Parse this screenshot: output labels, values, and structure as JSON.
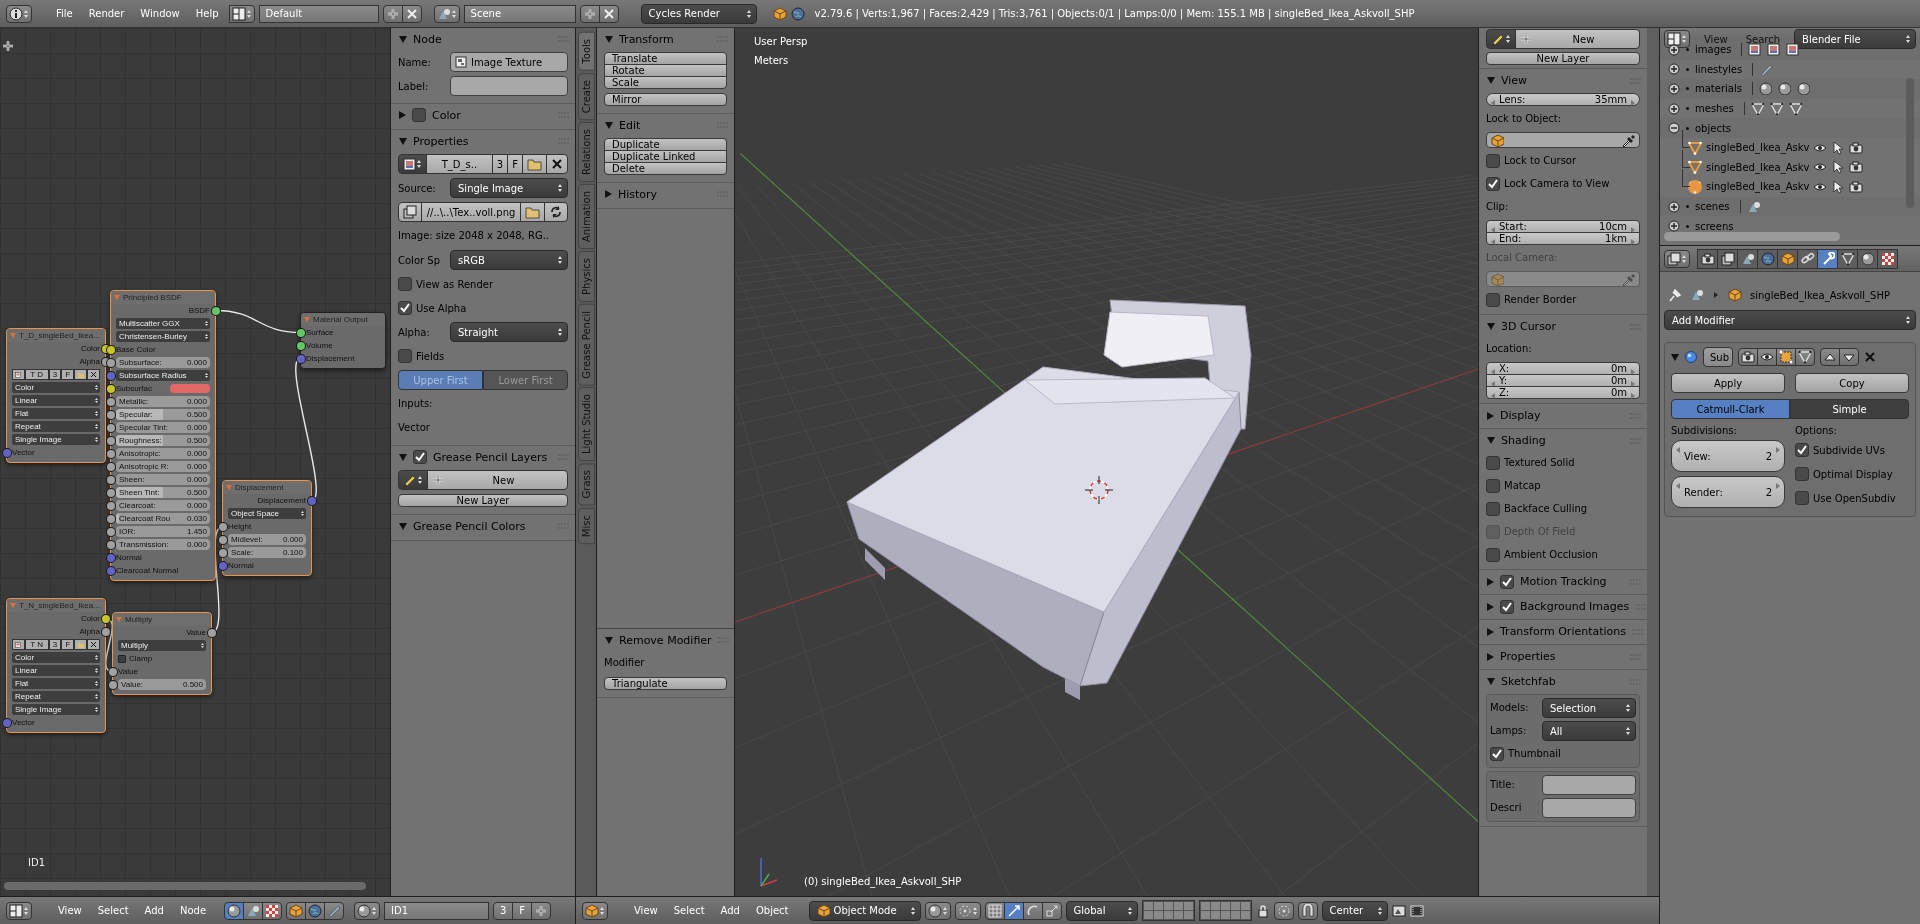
{
  "top_bar": {
    "menus": [
      "File",
      "Render",
      "Window",
      "Help"
    ],
    "layout": "Default",
    "scene": "Scene",
    "engine": "Cycles Render",
    "stats": "v2.79.6 | Verts:1,967 | Faces:2,429 | Tris:3,761 | Objects:0/1 | Lamps:0/0 | Mem: 155.1 MB | singleBed_Ikea_Askvoll_SHP"
  },
  "node_editor": {
    "tree_label": "ID1",
    "nodes": [
      {
        "title": "T_D_singleBed_Ikea...",
        "selected": true,
        "rows": [
          {
            "kind": "output",
            "text": "Color",
            "color": "#c7c729"
          },
          {
            "kind": "output",
            "text": "Alpha",
            "color": "#a1a1a1"
          },
          {
            "kind": "image_bar",
            "name": "T D",
            "users": "3",
            "fake": "F"
          },
          {
            "kind": "dropdown",
            "value": "Color"
          },
          {
            "kind": "dropdown",
            "value": "Linear"
          },
          {
            "kind": "dropdown",
            "value": "Flat"
          },
          {
            "kind": "dropdown",
            "value": "Repeat"
          },
          {
            "kind": "dropdown",
            "value": "Single Image"
          },
          {
            "kind": "input",
            "text": "Vector",
            "color": "#6363c7"
          }
        ]
      },
      {
        "title": "Principled BSDF",
        "selected": true,
        "rows": [
          {
            "kind": "output",
            "text": "BSDF",
            "color": "#63c763"
          },
          {
            "kind": "dropdown",
            "value": "Multiscatter GGX"
          },
          {
            "kind": "dropdown",
            "value": "Christensen-Burley"
          },
          {
            "kind": "input",
            "text": "Base Color",
            "color": "#c7c729"
          },
          {
            "kind": "value",
            "label": "Subsurface:",
            "value": "0.000",
            "color": "#a1a1a1",
            "level": 0
          },
          {
            "kind": "vector",
            "label": "Subsurface Radius",
            "color": "#6363c7"
          },
          {
            "kind": "swatch",
            "label": "Subsurfac",
            "socket": {
              "color": "#c7c729"
            },
            "color": "#e36868"
          },
          {
            "kind": "value",
            "label": "Metallic:",
            "value": "0.000",
            "color": "#a1a1a1",
            "level": 0
          },
          {
            "kind": "value",
            "label": "Specular:",
            "value": "0.500",
            "color": "#a1a1a1",
            "level": 0.5
          },
          {
            "kind": "value",
            "label": "Specular Tint:",
            "value": "0.000",
            "color": "#a1a1a1",
            "level": 0
          },
          {
            "kind": "value",
            "label": "Roughness:",
            "value": "0.500",
            "color": "#a1a1a1",
            "level": 0.5
          },
          {
            "kind": "value",
            "label": "Anisotropic:",
            "value": "0.000",
            "color": "#a1a1a1",
            "level": 0
          },
          {
            "kind": "value",
            "label": "Anisotropic R:",
            "value": "0.000",
            "color": "#a1a1a1",
            "level": 0
          },
          {
            "kind": "value",
            "label": "Sheen:",
            "value": "0.000",
            "color": "#a1a1a1",
            "level": 0
          },
          {
            "kind": "value",
            "label": "Sheen Tint:",
            "value": "0.500",
            "color": "#a1a1a1",
            "level": 0.5
          },
          {
            "kind": "value",
            "label": "Clearcoat:",
            "value": "0.000",
            "color": "#a1a1a1",
            "level": 0
          },
          {
            "kind": "value",
            "label": "Clearcoat Rou",
            "value": "0.030",
            "color": "#a1a1a1",
            "level": 0.03
          },
          {
            "kind": "value",
            "label": "IOR:",
            "value": "1.450",
            "color": "#a1a1a1"
          },
          {
            "kind": "value",
            "label": "Transmission:",
            "value": "0.000",
            "color": "#a1a1a1",
            "level": 0
          },
          {
            "kind": "input",
            "text": "Normal",
            "color": "#6363c7"
          },
          {
            "kind": "input",
            "text": "Clearcoat Normal",
            "color": "#6363c7"
          }
        ]
      },
      {
        "title": "Material Output",
        "selected": false,
        "rows": [
          {
            "kind": "input",
            "text": "Surface",
            "color": "#63c763"
          },
          {
            "kind": "input",
            "text": "Volume",
            "color": "#63c763"
          },
          {
            "kind": "input",
            "text": "Displacement",
            "color": "#6363c7"
          }
        ]
      },
      {
        "title": "Displacement",
        "selected": true,
        "rows": [
          {
            "kind": "output",
            "text": "Displacement",
            "color": "#6363c7"
          },
          {
            "kind": "dropdown",
            "value": "Object Space"
          },
          {
            "kind": "input",
            "text": "Height",
            "color": "#a1a1a1"
          },
          {
            "kind": "value",
            "label": "Midlevel:",
            "value": "0.000",
            "color": "#a1a1a1"
          },
          {
            "kind": "value",
            "label": "Scale:",
            "value": "0.100",
            "color": "#a1a1a1"
          },
          {
            "kind": "input",
            "text": "Normal",
            "color": "#6363c7"
          }
        ]
      },
      {
        "title": "T_N_singleBed_Ikea...",
        "selected": true,
        "rows": [
          {
            "kind": "output",
            "text": "Color",
            "color": "#c7c729"
          },
          {
            "kind": "output",
            "text": "Alpha",
            "color": "#a1a1a1"
          },
          {
            "kind": "image_bar",
            "name": "T N",
            "users": "3",
            "fake": "F"
          },
          {
            "kind": "dropdown",
            "value": "Color"
          },
          {
            "kind": "dropdown",
            "value": "Linear"
          },
          {
            "kind": "dropdown",
            "value": "Flat"
          },
          {
            "kind": "dropdown",
            "value": "Repeat"
          },
          {
            "kind": "dropdown",
            "value": "Single Image"
          },
          {
            "kind": "input",
            "text": "Vector",
            "color": "#6363c7"
          }
        ]
      },
      {
        "title": "Multiply",
        "selected": true,
        "rows": [
          {
            "kind": "output",
            "text": "Value",
            "color": "#a1a1a1"
          },
          {
            "kind": "dropdown",
            "value": "Multiply"
          },
          {
            "kind": "checkbox",
            "text": "Clamp",
            "checked": false
          },
          {
            "kind": "input",
            "text": "Value",
            "color": "#a1a1a1"
          },
          {
            "kind": "value",
            "label": "Value:",
            "value": "0.500",
            "color": "#a1a1a1"
          }
        ]
      }
    ]
  },
  "node_panel": {
    "sections": [
      {
        "title": "Node",
        "expanded": true,
        "items": [
          {
            "kind": "field",
            "label": "Name:",
            "value": "Image Texture"
          },
          {
            "kind": "field",
            "label": "Label:"
          }
        ]
      },
      {
        "title": "Color",
        "expanded": false,
        "checkbox": false
      },
      {
        "title": "Properties",
        "expanded": true,
        "items": [
          {
            "kind": "image_bar",
            "name": "T_D_s..",
            "users": "3",
            "fake": "F"
          },
          {
            "kind": "dropdown",
            "label": "Source:",
            "value": "Single Image"
          },
          {
            "kind": "file",
            "value": "//..\\..\\Tex..voll.png"
          },
          {
            "kind": "text",
            "text": "Image: size 2048 x 2048, RG.."
          },
          {
            "kind": "dropdown",
            "label": "Color Sp",
            "value": "sRGB"
          },
          {
            "kind": "checkbox",
            "text": "View as Render",
            "checked": false
          },
          {
            "kind": "checkbox",
            "text": "Use Alpha",
            "checked": true
          },
          {
            "kind": "dropdown",
            "label": "Alpha:",
            "value": "Straight"
          },
          {
            "kind": "checkbox",
            "text": "Fields",
            "checked": false
          },
          {
            "kind": "toggle",
            "options": [
              {
                "text": "Upper First",
                "selected": true
              },
              {
                "text": "Lower First",
                "selected": false
              }
            ]
          },
          {
            "kind": "text",
            "text": "Inputs:"
          },
          {
            "kind": "text",
            "text": "Vector"
          }
        ]
      },
      {
        "title": "Grease Pencil Layers",
        "expanded": true,
        "checkbox": true,
        "items": [
          {
            "kind": "new_bar",
            "text": "New"
          },
          {
            "kind": "button",
            "text": "New Layer"
          }
        ]
      },
      {
        "title": "Grease Pencil Colors",
        "expanded": true
      }
    ]
  },
  "tool_tabs": [
    {
      "text": "Tools",
      "selected": true
    },
    {
      "text": "Create",
      "selected": false
    },
    {
      "text": "Relations",
      "selected": false
    },
    {
      "text": "Animation",
      "selected": false
    },
    {
      "text": "Physics",
      "selected": false
    },
    {
      "text": "Grease Pencil",
      "selected": false
    },
    {
      "text": "Light Studio",
      "selected": false
    },
    {
      "text": "Grass",
      "selected": false
    },
    {
      "text": "Misc",
      "selected": false
    }
  ],
  "tool_shelf": {
    "sections": [
      {
        "title": "Transform",
        "expanded": true,
        "items": [
          {
            "kind": "stack",
            "items": [
              {
                "kind": "button",
                "text": "Translate"
              },
              {
                "kind": "button",
                "text": "Rotate"
              },
              {
                "kind": "button",
                "text": "Scale"
              }
            ]
          },
          {
            "kind": "button",
            "text": "Mirror"
          }
        ]
      },
      {
        "title": "Edit",
        "expanded": true,
        "items": [
          {
            "kind": "stack",
            "items": [
              {
                "kind": "button",
                "text": "Duplicate"
              },
              {
                "kind": "button",
                "text": "Duplicate Linked"
              },
              {
                "kind": "button",
                "text": "Delete"
              }
            ]
          }
        ]
      },
      {
        "title": "History",
        "expanded": false
      }
    ]
  },
  "operator_panel": {
    "sections": [
      {
        "title": "Remove Modifier",
        "expanded": true,
        "items": [
          {
            "kind": "text",
            "text": "Modifier"
          },
          {
            "kind": "button",
            "text": "Triangulate"
          }
        ]
      }
    ]
  },
  "viewport": {
    "view_name": "User Persp",
    "units": "Meters",
    "object_label": "(0) singleBed_Ikea_Askvoll_SHP"
  },
  "n_panel": {
    "top": [
      {
        "kind": "new_bar",
        "text": "New"
      },
      {
        "kind": "button",
        "text": "New Layer"
      }
    ],
    "sections": [
      {
        "title": "View",
        "expanded": true,
        "items": [
          {
            "kind": "number",
            "label": "Lens:",
            "value": "35mm"
          },
          {
            "kind": "text",
            "text": "Lock to Object:",
            "disabled": false
          },
          {
            "kind": "object_field",
            "disabled": false
          },
          {
            "kind": "checkbox",
            "text": "Lock to Cursor",
            "checked": false
          },
          {
            "kind": "checkbox",
            "text": "Lock Camera to View",
            "checked": true
          },
          {
            "kind": "text",
            "text": "Clip:",
            "disabled": false
          },
          {
            "kind": "stack",
            "items": [
              {
                "kind": "number",
                "label": "Start:",
                "value": "10cm"
              },
              {
                "kind": "number",
                "label": "End:",
                "value": "1km"
              }
            ]
          },
          {
            "kind": "text",
            "text": "Local Camera:",
            "disabled": true
          },
          {
            "kind": "object_field",
            "disabled": true
          },
          {
            "kind": "checkbox",
            "text": "Render Border",
            "checked": false
          }
        ]
      },
      {
        "title": "3D Cursor",
        "expanded": true,
        "items": [
          {
            "kind": "text",
            "text": "Location:"
          },
          {
            "kind": "stack",
            "items": [
              {
                "kind": "number",
                "label": "X:",
                "value": "0m"
              },
              {
                "kind": "number",
                "label": "Y:",
                "value": "0m"
              },
              {
                "kind": "number",
                "label": "Z:",
                "value": "0m"
              }
            ]
          }
        ]
      },
      {
        "title": "Display",
        "expanded": false
      },
      {
        "title": "Shading",
        "expanded": true,
        "items": [
          {
            "kind": "checkbox",
            "text": "Textured Solid",
            "checked": false,
            "disabled": false
          },
          {
            "kind": "checkbox",
            "text": "Matcap",
            "checked": false,
            "disabled": false
          },
          {
            "kind": "checkbox",
            "text": "Backface Culling",
            "checked": false,
            "disabled": false
          },
          {
            "kind": "checkbox",
            "text": "Depth Of Field",
            "checked": false,
            "disabled": true
          },
          {
            "kind": "checkbox",
            "text": "Ambient Occlusion",
            "checked": false,
            "disabled": false
          }
        ]
      },
      {
        "title": "Motion Tracking",
        "expanded": false,
        "checkbox": true
      },
      {
        "title": "Background Images",
        "expanded": false,
        "checkbox": true
      },
      {
        "title": "Transform Orientations",
        "expanded": false
      },
      {
        "title": "Properties",
        "expanded": false
      },
      {
        "title": "Sketchfab",
        "expanded": true,
        "items": [
          {
            "kind": "box",
            "items": [
              {
                "kind": "dropdown",
                "label": "Models:",
                "value": "Selection"
              },
              {
                "kind": "dropdown",
                "label": "Lamps:",
                "value": "All"
              },
              {
                "kind": "checkbox",
                "text": "Thumbnail",
                "checked": true
              }
            ]
          },
          {
            "kind": "box",
            "items": [
              {
                "kind": "field",
                "label": "Title:"
              },
              {
                "kind": "field",
                "label": "Descri"
              }
            ]
          }
        ]
      }
    ]
  },
  "outliner": {
    "menus": [
      "View",
      "Search"
    ],
    "display": "Blender File",
    "items": [
      {
        "label": "images",
        "kind": "image",
        "expanded": false
      },
      {
        "label": "linestyles",
        "kind": "brush",
        "expanded": false
      },
      {
        "label": "materials",
        "kind": "material",
        "expanded": false
      },
      {
        "label": "meshes",
        "kind": "mesh",
        "expanded": false
      },
      {
        "label": "objects",
        "kind": "none",
        "expanded": true,
        "children": [
          {
            "label": "singleBed_Ikea_Askv",
            "selected": false
          },
          {
            "label": "singleBed_Ikea_Askv",
            "selected": false
          },
          {
            "label": "singleBed_Ikea_Askv",
            "selected": true
          }
        ]
      },
      {
        "label": "scenes",
        "kind": "scene",
        "expanded": false
      },
      {
        "label": "screens",
        "kind": "none",
        "expanded": false
      }
    ]
  },
  "properties": {
    "tabs": [
      {
        "kind": "render",
        "selected": false
      },
      {
        "kind": "layers",
        "selected": false
      },
      {
        "kind": "scene",
        "selected": false
      },
      {
        "kind": "world",
        "selected": false
      },
      {
        "kind": "object",
        "selected": false
      },
      {
        "kind": "constraints",
        "selected": false
      },
      {
        "kind": "modifiers",
        "selected": true
      },
      {
        "kind": "data",
        "selected": false
      },
      {
        "kind": "material",
        "selected": false
      },
      {
        "kind": "texture",
        "selected": false
      }
    ],
    "context": "singleBed_Ikea_Askvoll_SHP",
    "add_modifier": "Add Modifier",
    "modifier": {
      "name": "Sub",
      "expanded": true,
      "buttons": [
        "Apply",
        "Copy"
      ],
      "modes": [
        {
          "text": "Catmull-Clark",
          "selected": true
        },
        {
          "text": "Simple",
          "selected": false
        }
      ],
      "subdivisions_label": "Subdivisions:",
      "levels": [
        {
          "label": "View:",
          "value": "2"
        },
        {
          "label": "Render:",
          "value": "2"
        }
      ],
      "options_label": "Options:",
      "options": [
        {
          "text": "Subdivide UVs",
          "checked": true
        },
        {
          "text": "Optimal Display",
          "checked": false
        },
        {
          "text": "Use OpenSubdiv",
          "checked": false
        }
      ]
    }
  },
  "node_header": {
    "menus": [
      "View",
      "Select",
      "Add",
      "Node"
    ],
    "tree": "ID1",
    "users": "3",
    "fake": "F"
  },
  "view3d_header": {
    "menus": [
      "View",
      "Select",
      "Add",
      "Object"
    ],
    "mode": "Object Mode",
    "orientation": "Global",
    "pivot": "Center"
  }
}
